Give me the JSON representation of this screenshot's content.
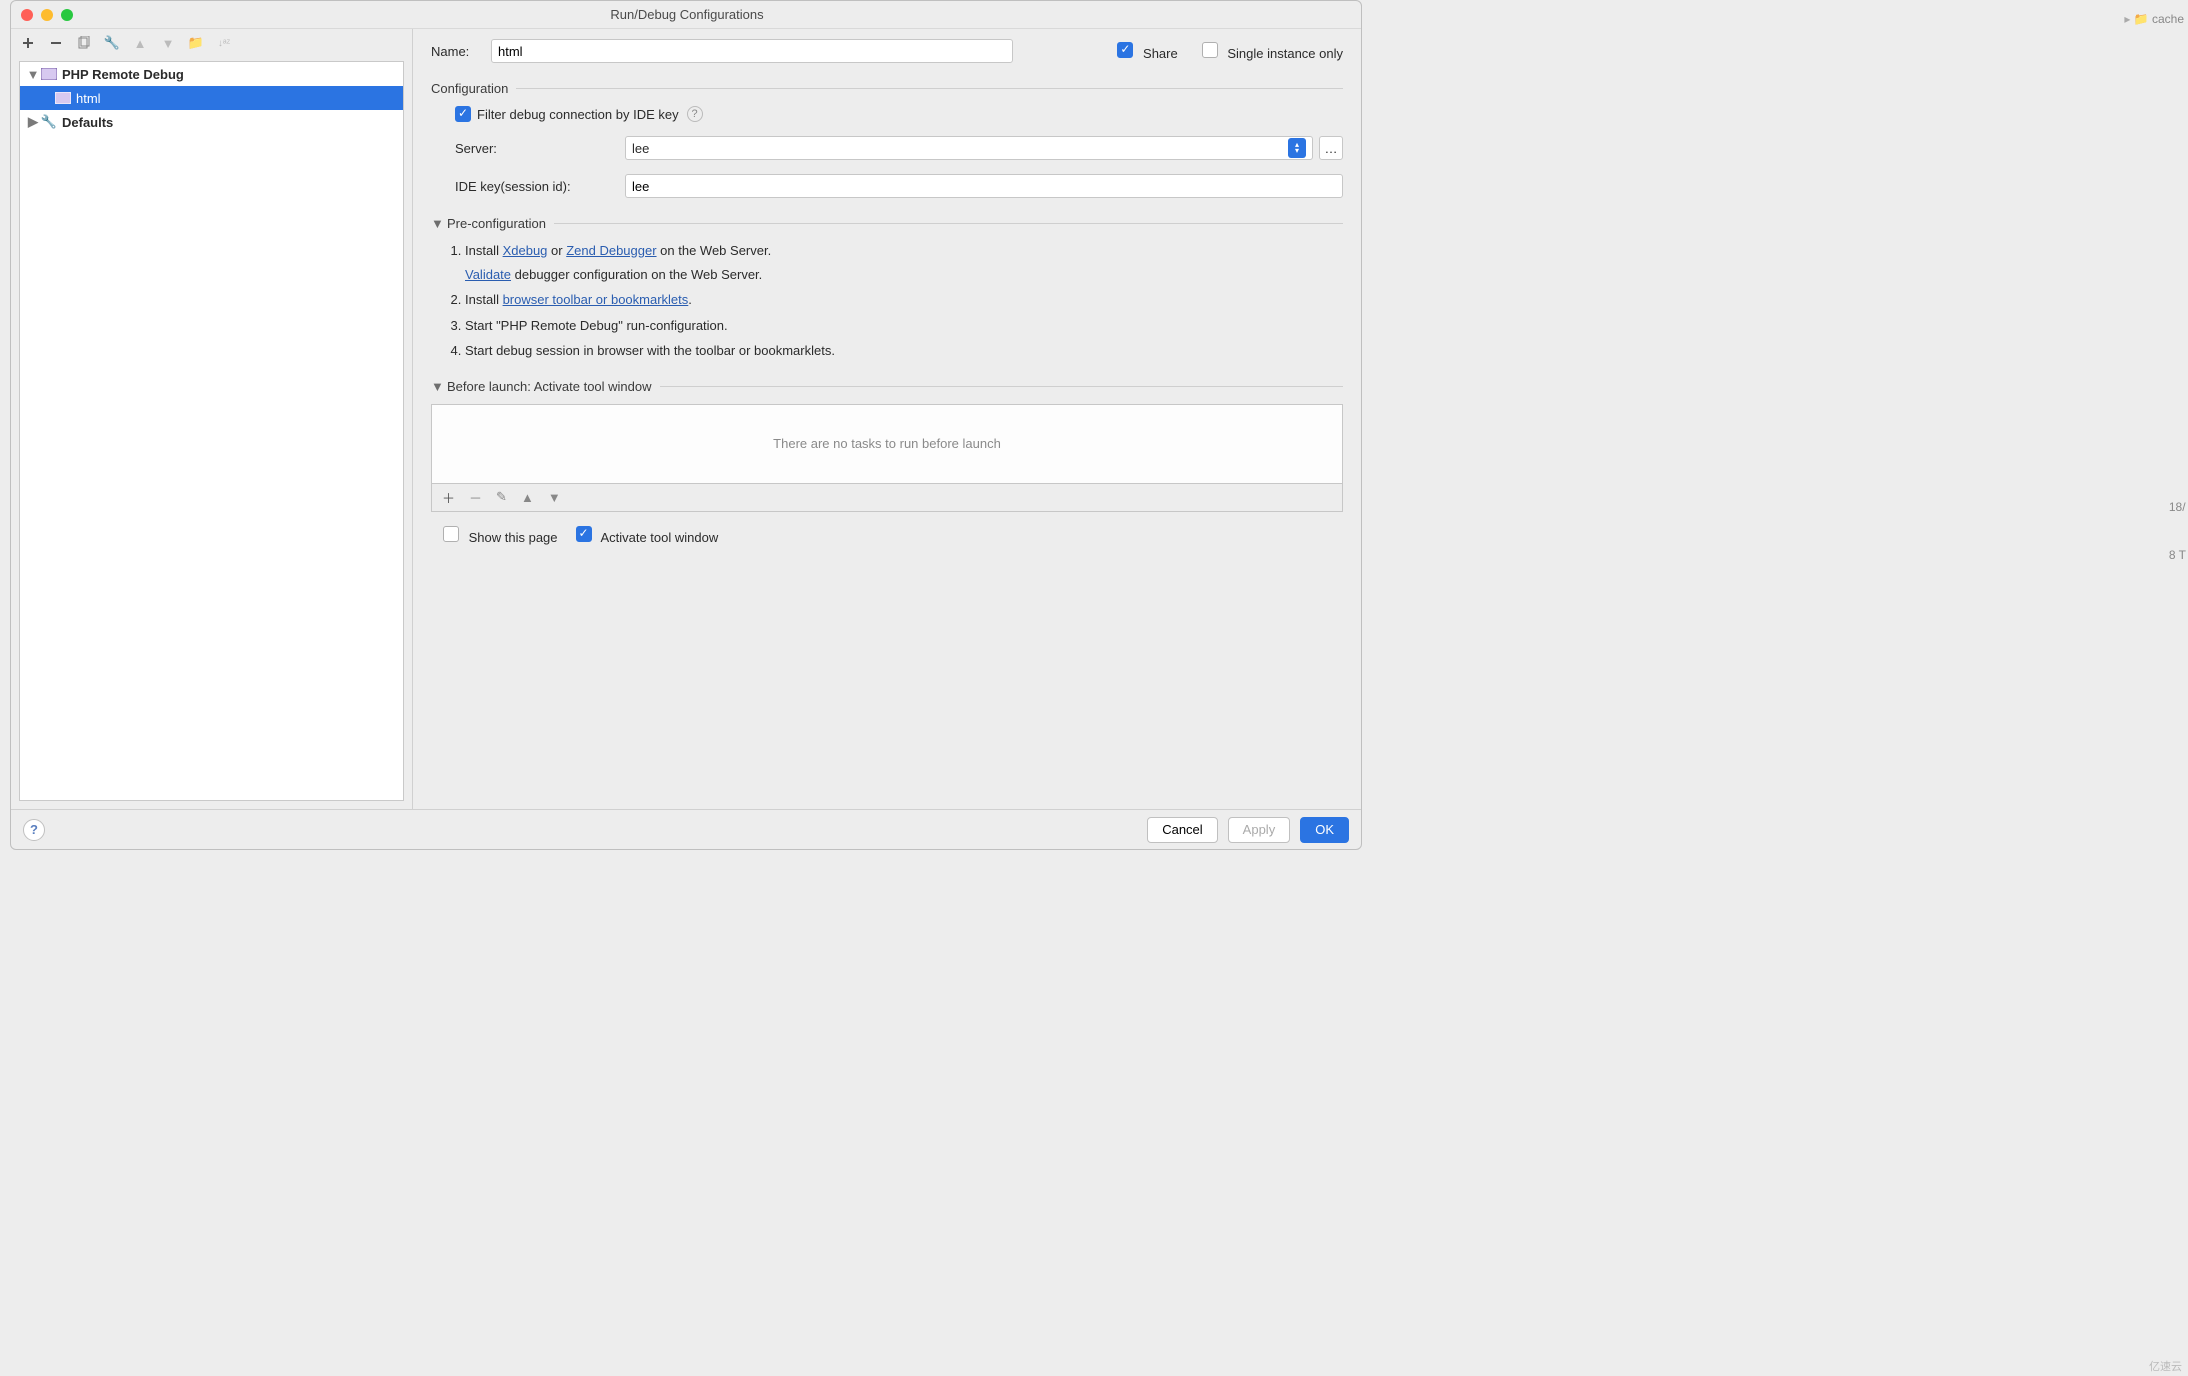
{
  "window": {
    "title": "Run/Debug Configurations"
  },
  "tree": {
    "root": "PHP Remote Debug",
    "child": "html",
    "defaults": "Defaults"
  },
  "form": {
    "name_label": "Name:",
    "name_value": "html",
    "share_label": "Share",
    "single_instance_label": "Single instance only",
    "config_section": "Configuration",
    "filter_label": "Filter debug connection by IDE key",
    "server_label": "Server:",
    "server_value": "lee",
    "ide_key_label": "IDE key(session id):",
    "ide_key_value": "lee",
    "preconfig_section": "Pre-configuration",
    "li1_a": "Install ",
    "li1_link1": "Xdebug",
    "li1_b": " or ",
    "li1_link2": "Zend Debugger",
    "li1_c": " on the Web Server.",
    "li1_sub_link": "Validate",
    "li1_sub": " debugger configuration on the Web Server.",
    "li2_a": "Install ",
    "li2_link": "browser toolbar or bookmarklets",
    "li2_b": ".",
    "li3": "Start \"PHP Remote Debug\" run-configuration.",
    "li4": "Start debug session in browser with the toolbar or bookmarklets.",
    "before_launch_section": "Before launch: Activate tool window",
    "no_tasks": "There are no tasks to run before launch",
    "show_page": "Show this page",
    "activate_tool": "Activate tool window"
  },
  "footer": {
    "cancel": "Cancel",
    "apply": "Apply",
    "ok": "OK"
  },
  "background": {
    "cache": "cache",
    "frag1": "18/",
    "frag2": "8 T"
  },
  "watermark": "亿速云"
}
